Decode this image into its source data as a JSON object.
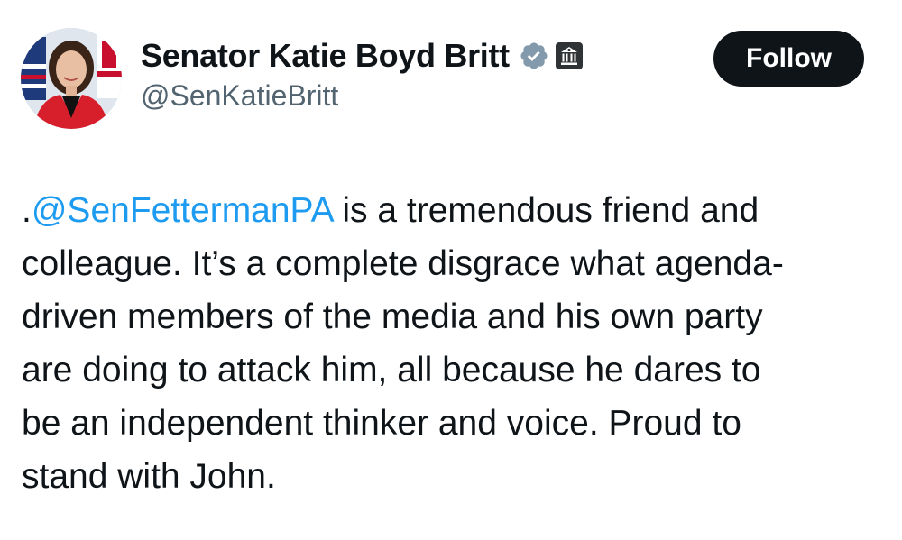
{
  "author": {
    "display_name": "Senator Katie Boyd Britt",
    "handle": "@SenKatieBritt",
    "verified_badge_icon": "verified-check-icon",
    "verified_badge_color": "#829aab",
    "affiliation_badge_icon": "government-building-icon"
  },
  "follow_button": {
    "label": "Follow"
  },
  "tweet": {
    "lines": [
      {
        "prefix": ".",
        "mention": "@SenFettermanPA",
        "text": " is a tremendous friend and"
      },
      {
        "text": "colleague. It’s a complete disgrace what agenda-"
      },
      {
        "text": "driven members of the media and his own party"
      },
      {
        "text": "are doing to attack him, all because he dares to"
      },
      {
        "text": "be an independent thinker and voice. Proud to"
      },
      {
        "text": "stand with John."
      }
    ]
  },
  "colors": {
    "text": "#0f1419",
    "secondary_text": "#536471",
    "link": "#1d9bf0",
    "button_bg": "#0f1419",
    "button_text": "#ffffff"
  }
}
